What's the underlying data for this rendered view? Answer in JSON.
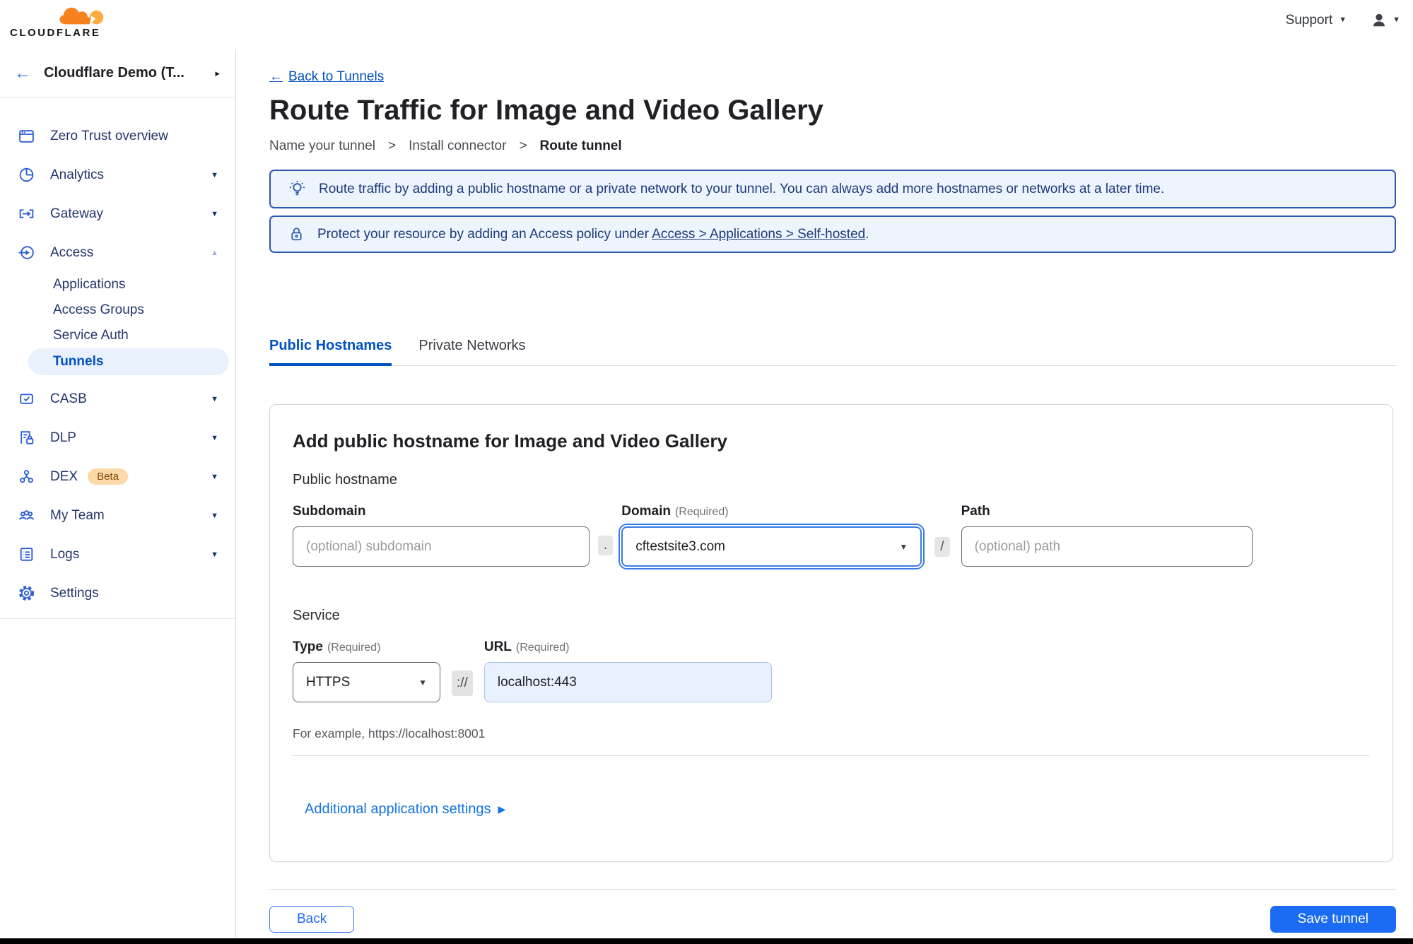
{
  "colors": {
    "accent_blue": "#0051c3",
    "button_blue": "#1b6cf2",
    "banner_bg": "#edf4fe",
    "banner_border": "#2e56ad",
    "selected_item_bg": "#e9f1fc",
    "logo_orange": "#f6821f",
    "logo_orange_light": "#fbad41",
    "beta_badge_bg": "#fcd9a8",
    "beta_badge_text": "#864d0e",
    "url_input_bg": "#e9f1fe",
    "bottom_bar": "#000000"
  },
  "icons": {
    "caret_down": "▼",
    "caret_up": "▲",
    "caret_right": "▸",
    "arrow_left": "←",
    "triangle_right": "▶",
    "breadcrumb_sep": ">"
  },
  "header": {
    "logo_text": "CLOUDFLARE",
    "support_label": "Support"
  },
  "sidebar": {
    "account_name": "Cloudflare Demo (T...",
    "items": [
      {
        "label": "Zero Trust overview"
      },
      {
        "label": "Analytics"
      },
      {
        "label": "Gateway"
      },
      {
        "label": "Access"
      },
      {
        "label": "Applications"
      },
      {
        "label": "Access Groups"
      },
      {
        "label": "Service Auth"
      },
      {
        "label": "Tunnels"
      },
      {
        "label": "CASB"
      },
      {
        "label": "DLP"
      },
      {
        "label": "DEX"
      },
      {
        "label": "My Team"
      },
      {
        "label": "Logs"
      },
      {
        "label": "Settings"
      }
    ],
    "dex_badge": "Beta"
  },
  "main": {
    "back_link": "Back to Tunnels",
    "title": "Route Traffic for Image and Video Gallery",
    "steps": [
      {
        "label": "Name your tunnel"
      },
      {
        "label": "Install connector"
      },
      {
        "label": "Route tunnel"
      }
    ],
    "banners": [
      {
        "text": "Route traffic by adding a public hostname or a private network to your tunnel. You can always add more hostnames or networks at a later time."
      },
      {
        "text_prefix": "Protect your resource by adding an Access policy under ",
        "link": "Access > Applications > Self-hosted",
        "suffix": "."
      }
    ],
    "tabs": [
      {
        "label": "Public Hostnames"
      },
      {
        "label": "Private Networks"
      }
    ]
  },
  "form": {
    "card_title": "Add public hostname for Image and Video Gallery",
    "public_hostname_label": "Public hostname",
    "subdomain": {
      "label": "Subdomain",
      "placeholder": "(optional) subdomain"
    },
    "dot_separator": ".",
    "domain": {
      "label": "Domain",
      "required": "(Required)",
      "value": "cftestsite3.com"
    },
    "slash_separator": "/",
    "path": {
      "label": "Path",
      "placeholder": "(optional) path"
    },
    "service_label": "Service",
    "type": {
      "label": "Type",
      "required": "(Required)",
      "value": "HTTPS"
    },
    "scheme_separator": "://",
    "url": {
      "label": "URL",
      "required": "(Required)",
      "value": "localhost:443"
    },
    "example": "For example, https://localhost:8001",
    "additional_settings": "Additional application settings"
  },
  "footer": {
    "back_label": "Back",
    "save_label": "Save tunnel"
  }
}
